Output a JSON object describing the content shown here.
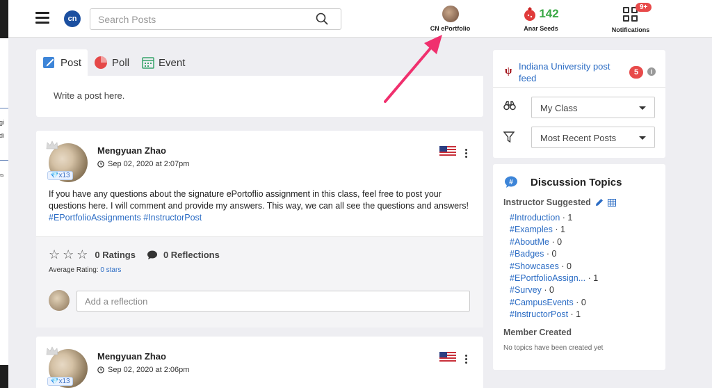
{
  "left_peek": {
    "lines": [
      "egi",
      "adi",
      "ens"
    ]
  },
  "header": {
    "logo_text": "cn",
    "search_placeholder": "Search Posts",
    "portfolio_label": "CN ePortfolio",
    "seeds_count": "142",
    "seeds_label": "Anar Seeds",
    "notifications_badge": "9+",
    "notifications_label": "Notifications"
  },
  "composer": {
    "tabs": [
      {
        "label": "Post",
        "icon": "post-icon",
        "active": true
      },
      {
        "label": "Poll",
        "icon": "poll-icon",
        "active": false
      },
      {
        "label": "Event",
        "icon": "calendar-icon",
        "active": false
      }
    ],
    "placeholder": "Write a post here."
  },
  "posts": [
    {
      "author": "Mengyuan Zhao",
      "date": "Sep 02, 2020 at 2:07pm",
      "gem_badge": "x13",
      "body_text": "If you have any questions about the signature ePortoflio assignment in this class, feel free to post your questions here. I will comment and provide my answers. This way, we can all see the questions and answers! ",
      "tags": [
        "#EPortfolioAssignments",
        "#InstructorPost"
      ],
      "ratings_label": "0 Ratings",
      "reflections_label": "0 Reflections",
      "avg_label": "Average Rating: ",
      "avg_value": "0 stars",
      "reflection_placeholder": "Add a reflection"
    },
    {
      "author": "Mengyuan Zhao",
      "date": "Sep 02, 2020 at 2:06pm",
      "gem_badge": "x13"
    }
  ],
  "sidebar": {
    "feed_link": "Indiana University post feed",
    "feed_mark": "ψ",
    "feed_count": "5",
    "class_select": "My Class",
    "sort_select": "Most Recent Posts",
    "topics_title": "Discussion Topics",
    "instructor_heading": "Instructor Suggested",
    "topics": [
      {
        "tag": "#Introduction",
        "count": " · 1"
      },
      {
        "tag": "#Examples",
        "count": " · 1"
      },
      {
        "tag": "#AboutMe",
        "count": " · 0"
      },
      {
        "tag": "#Badges",
        "count": " · 0"
      },
      {
        "tag": "#Showcases",
        "count": " · 0"
      },
      {
        "tag": "#EPortfolioAssign...",
        "count": " · 1"
      },
      {
        "tag": "#Survey",
        "count": " · 0"
      },
      {
        "tag": "#CampusEvents",
        "count": " · 0"
      },
      {
        "tag": "#InstructorPost",
        "count": " · 1"
      }
    ],
    "member_heading": "Member Created",
    "member_empty": "No topics have been created yet"
  },
  "colors": {
    "accent_blue": "#2b6cc4",
    "seeds_green": "#3aa845",
    "badge_red": "#e84a4a",
    "arrow_pink": "#f0306e"
  }
}
